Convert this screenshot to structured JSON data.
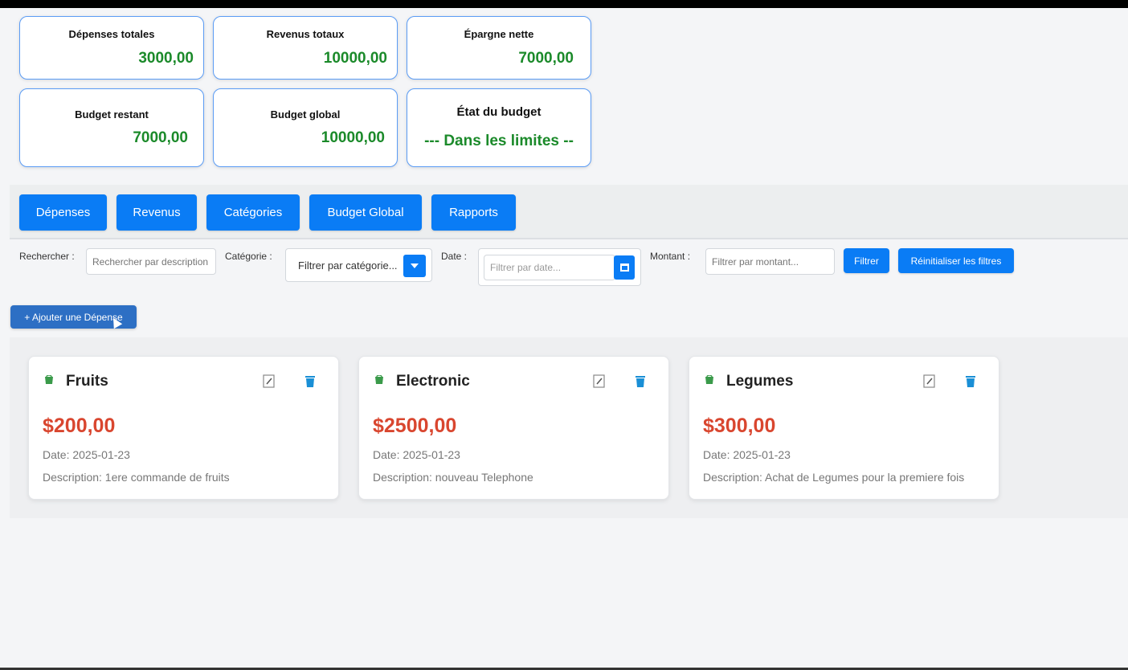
{
  "summary": {
    "depenses_totales": {
      "label": "Dépenses totales",
      "value": "3000,00"
    },
    "revenus_totaux": {
      "label": "Revenus totaux",
      "value": "10000,00"
    },
    "epargne_nette": {
      "label": "Épargne nette",
      "value": "7000,00"
    },
    "budget_restant": {
      "label": "Budget restant",
      "value": "7000,00"
    },
    "budget_global": {
      "label": "Budget global",
      "value": "10000,00"
    },
    "etat_budget": {
      "label": "État du budget",
      "value": "--- Dans les limites --"
    }
  },
  "tabs": [
    "Dépenses",
    "Revenus",
    "Catégories",
    "Budget Global",
    "Rapports"
  ],
  "filters": {
    "search_label": "Rechercher :",
    "search_placeholder": "Rechercher par description",
    "category_label": "Catégorie :",
    "category_value": "Filtrer par catégorie...",
    "date_label": "Date :",
    "date_placeholder": "Filtrer par date...",
    "amount_label": "Montant :",
    "amount_placeholder": "Filtrer par montant...",
    "filter_button": "Filtrer",
    "reset_button": "Réinitialiser les filtres"
  },
  "add_button": "+ Ajouter une Dépense",
  "expenses": [
    {
      "name": "Fruits",
      "amount": "$200,00",
      "date": "Date: 2025-01-23",
      "description": "Description: 1ere commande de fruits"
    },
    {
      "name": "Electronic",
      "amount": "$2500,00",
      "date": "Date: 2025-01-23",
      "description": "Description: nouveau Telephone"
    },
    {
      "name": "Legumes",
      "amount": "$300,00",
      "date": "Date: 2025-01-23",
      "description": "Description: Achat de Legumes pour la premiere fois"
    }
  ],
  "colors": {
    "primary": "#0a7cf5",
    "positive": "#1b8a2a",
    "amount": "#d9462f",
    "card_border": "#5b9cf5"
  },
  "icons": {
    "category": "category-icon",
    "edit": "edit-icon",
    "delete": "trash-icon",
    "caret": "chevron-down-icon",
    "calendar": "calendar-icon"
  }
}
